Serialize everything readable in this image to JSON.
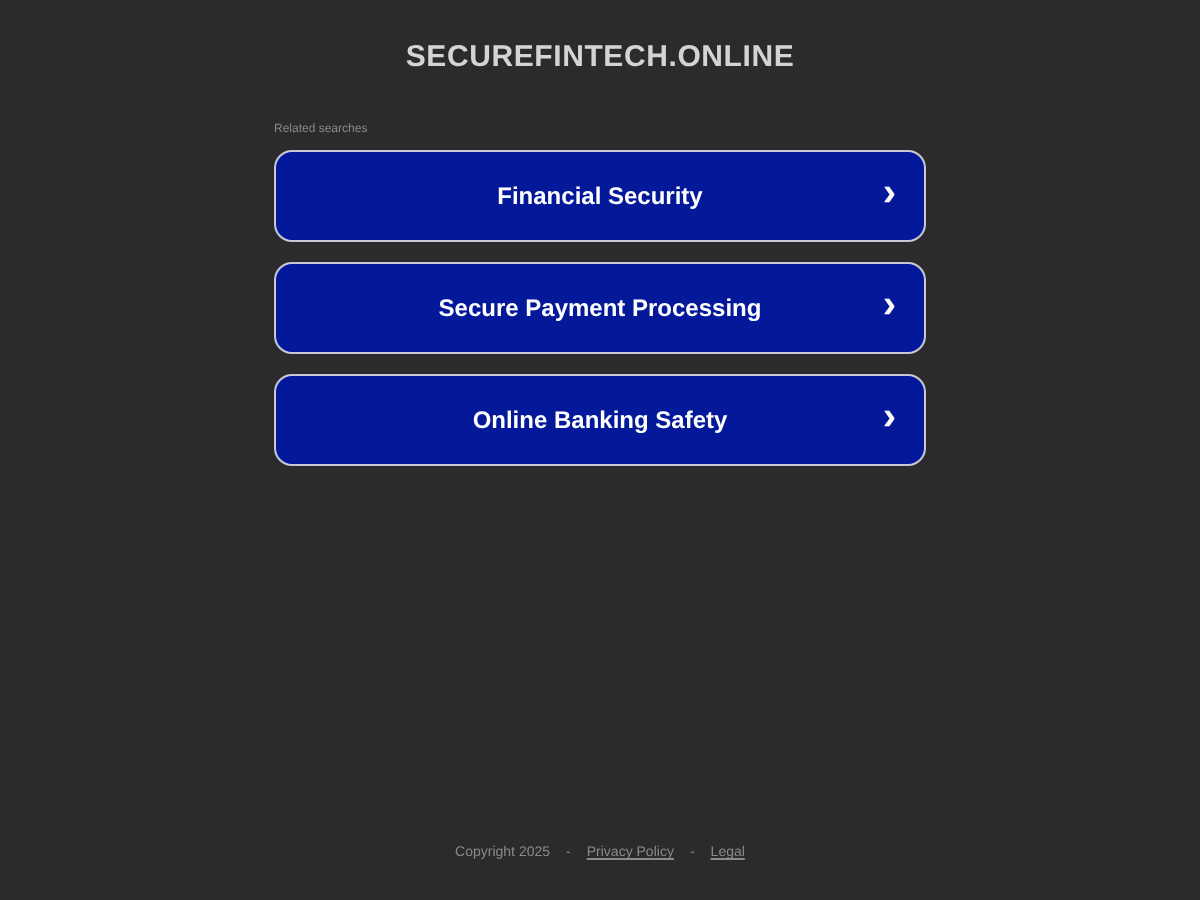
{
  "site_title": "SECUREFINTECH.ONLINE",
  "related_label": "Related searches",
  "links": [
    {
      "label": "Financial Security",
      "chevron": "›"
    },
    {
      "label": "Secure Payment Processing",
      "chevron": "›"
    },
    {
      "label": "Online Banking Safety",
      "chevron": "›"
    }
  ],
  "footer": {
    "copyright": "Copyright 2025",
    "separator_1": "-",
    "privacy": "Privacy Policy",
    "separator_2": "-",
    "legal": "Legal"
  }
}
